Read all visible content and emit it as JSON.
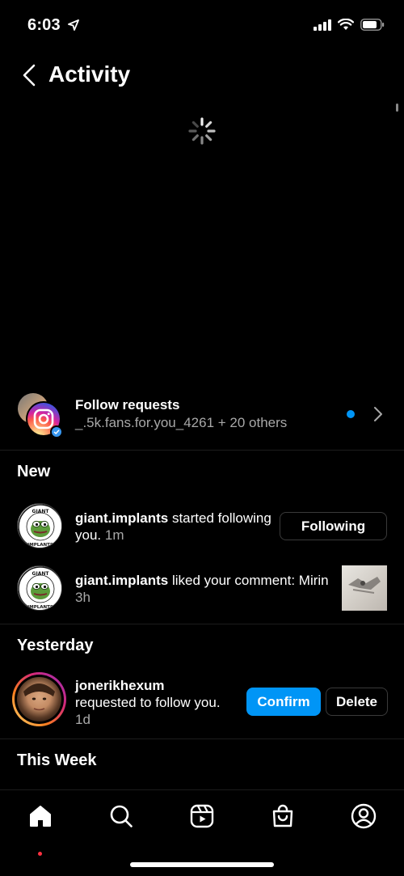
{
  "status_bar": {
    "time": "6:03"
  },
  "header": {
    "title": "Activity"
  },
  "follow_requests": {
    "title": "Follow requests",
    "subtitle": "_.5k.fans.for.you_4261 + 20 others"
  },
  "sections": {
    "new": "New",
    "yesterday": "Yesterday",
    "this_week": "This Week"
  },
  "notifications": [
    {
      "username": "giant.implants",
      "action": " started following you.",
      "time": "1m",
      "button_label": "Following"
    },
    {
      "username": "giant.implants",
      "action": " liked your comment: Mirin",
      "time": "3h"
    },
    {
      "username": "jonerikhexum",
      "action": "requested to follow you.",
      "time": "1d",
      "confirm_label": "Confirm",
      "delete_label": "Delete"
    }
  ],
  "avatar_text": {
    "top": "GIANT",
    "bottom": "IMPLANTS"
  },
  "tabs": [
    "home-icon",
    "search-icon",
    "reels-icon",
    "shop-icon",
    "profile-icon"
  ],
  "colors": {
    "accent_blue": "#0095f6",
    "notification_red": "#ff3040"
  }
}
